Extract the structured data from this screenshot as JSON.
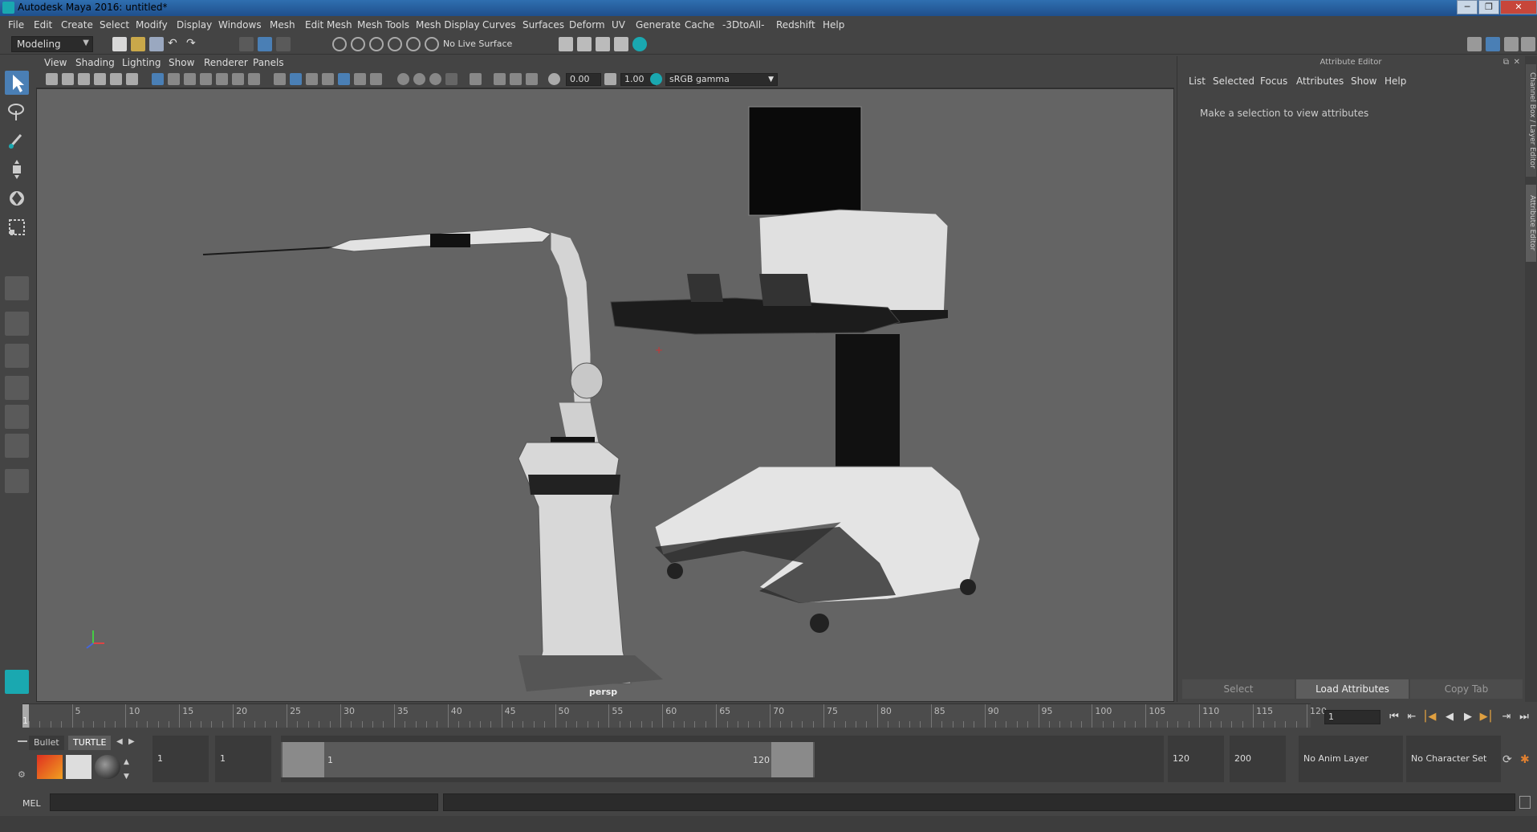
{
  "window": {
    "title": "Autodesk Maya 2016: untitled*",
    "btn_min": "─",
    "btn_max": "❐",
    "btn_close": "✕"
  },
  "menus": [
    "File",
    "Edit",
    "Create",
    "Select",
    "Modify",
    "Display",
    "Windows",
    "Mesh",
    "Edit Mesh",
    "Mesh Tools",
    "Mesh Display",
    "Curves",
    "Surfaces",
    "Deform",
    "UV",
    "Generate",
    "Cache",
    "-3DtoAll-",
    "Redshift",
    "Help"
  ],
  "status": {
    "mode": "Modeling",
    "live_surface": "No Live Surface"
  },
  "viewport": {
    "menus": [
      "View",
      "Shading",
      "Lighting",
      "Show",
      "Renderer",
      "Panels"
    ],
    "exposure": "0.00",
    "gamma": "1.00",
    "color_space": "sRGB gamma",
    "camera_label": "persp"
  },
  "attribute_editor": {
    "title": "Attribute Editor",
    "tabs": [
      "List",
      "Selected",
      "Focus",
      "Attributes",
      "Show",
      "Help"
    ],
    "message": "Make a selection to view attributes",
    "buttons": {
      "select": "Select",
      "load": "Load Attributes",
      "copy": "Copy Tab"
    },
    "side_tab_top": "Channel Box / Layer Editor",
    "side_tab_bottom": "Attribute Editor"
  },
  "timeline": {
    "ticks": [
      "5",
      "10",
      "15",
      "20",
      "25",
      "30",
      "35",
      "40",
      "45",
      "50",
      "55",
      "60",
      "65",
      "70",
      "75",
      "80",
      "85",
      "90",
      "95",
      "100",
      "105",
      "110",
      "115",
      "120"
    ],
    "current_marker": "1",
    "current_frame": "1"
  },
  "range": {
    "shelf_tabs": [
      "Bullet",
      "TURTLE"
    ],
    "start_frame": "1",
    "playback_start": "1",
    "range_start_label": "1",
    "range_end_label": "120",
    "playback_end": "120",
    "end_frame": "200",
    "anim_layer": "No Anim Layer",
    "character_set": "No Character Set"
  },
  "mel": {
    "label": "MEL"
  },
  "colors": {
    "viewport_bg": "#646464",
    "ui_bg": "#444444",
    "accent_select": "#4a7fb5",
    "maya_teal": "#1aa8b0"
  }
}
